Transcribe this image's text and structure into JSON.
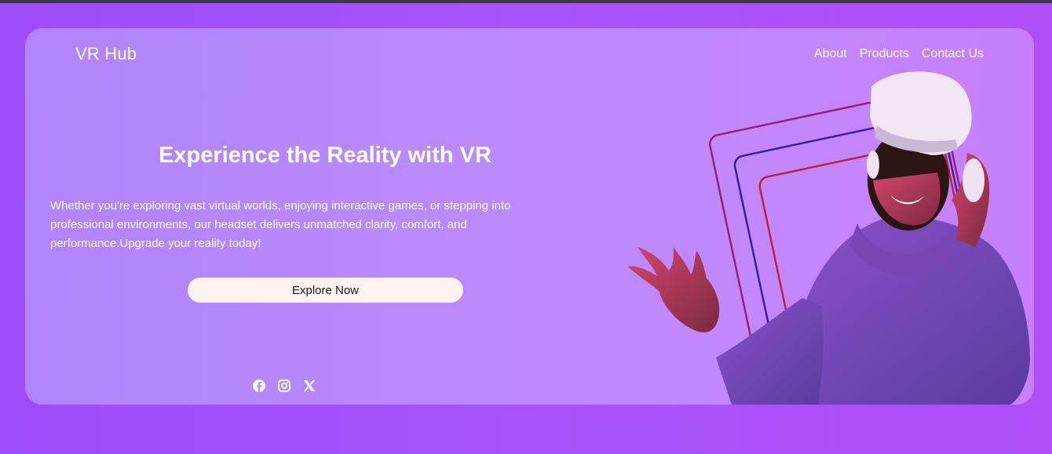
{
  "brand": {
    "name": "VR Hub"
  },
  "nav": {
    "items": [
      "About",
      "Products",
      "Contact Us"
    ]
  },
  "hero": {
    "title": "Experience the Reality with VR",
    "text": "Whether you're exploring vast virtual worlds, enjoying interactive games, or stepping into professional environments, our headset delivers unmatched clarity, comfort, and performance.Upgrade your reality today!",
    "cta_label": "Explore Now"
  },
  "social": {
    "icons": [
      "facebook-icon",
      "instagram-icon",
      "x-icon"
    ]
  },
  "colors": {
    "page_bg": "#a853fb",
    "card_bg": "#b98afd",
    "button_bg": "#fff3f1",
    "text": "#ffffff"
  }
}
